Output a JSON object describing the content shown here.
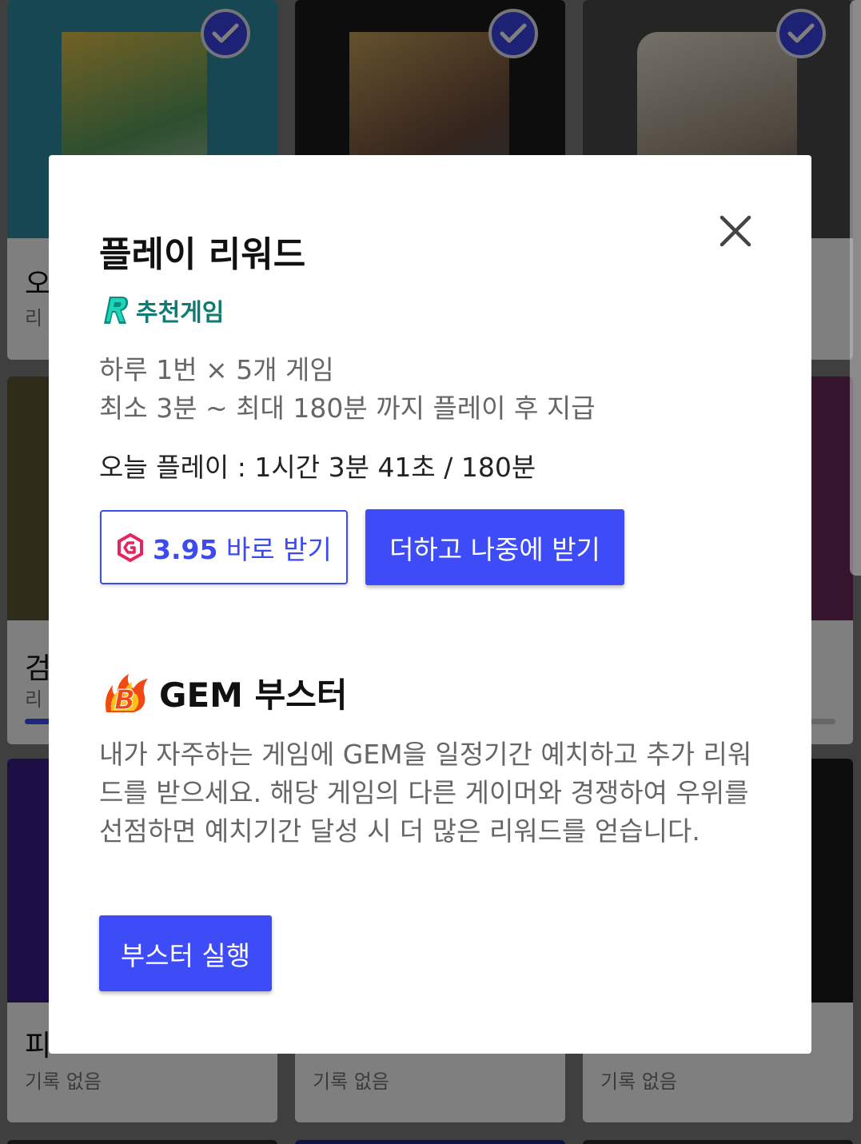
{
  "background": {
    "row1": [
      {
        "title": "오",
        "sub": "리",
        "checked": true
      },
      {
        "title": "",
        "sub": "",
        "checked": true
      },
      {
        "title": "",
        "sub": "",
        "checked": true
      }
    ],
    "row2": [
      {
        "title": "검",
        "sub": "리"
      },
      {
        "title": "",
        "sub": ""
      },
      {
        "title": "",
        "sub": ""
      }
    ],
    "row3": [
      {
        "title": "피",
        "sub": "기록 없음"
      },
      {
        "title": "",
        "sub": "기록 없음"
      },
      {
        "title": "",
        "sub": "기록 없음"
      }
    ]
  },
  "dialog": {
    "title": "플레이 리워드",
    "recommended_label": "추천게임",
    "desc_line1": "하루 1번 × 5개 게임",
    "desc_line2": "최소 3분 ~ 최대 180분 까지 플레이 후 지급",
    "today_play": "오늘 플레이 : 1시간 3분 41초 / 180분",
    "claim_amount": "3.95",
    "claim_label": "바로 받기",
    "later_label": "더하고 나중에 받기",
    "booster_title": "GEM 부스터",
    "booster_desc": "내가 자주하는 게임에 GEM을 일정기간 예치하고 추가 리워드를 받으세요. 해당 게임의 다른 게이머와 경쟁하여 우위를 선점하면 예치기간 달성 시 더 많은 리워드를 얻습니다.",
    "booster_button": "부스터 실행"
  },
  "colors": {
    "accent": "#3e4cf7",
    "teal": "#0f7b73",
    "gem_pink": "#e8245c"
  }
}
